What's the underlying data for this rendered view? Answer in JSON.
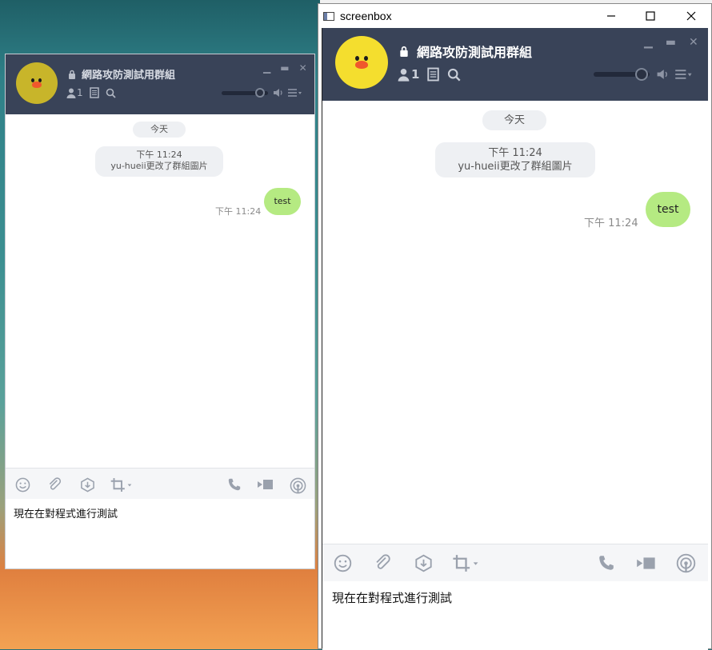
{
  "screenbox": {
    "title": "screenbox",
    "minimize": "—",
    "maximize": "☐",
    "close": "✕"
  },
  "chat": {
    "group_name": "網路攻防測試用群組",
    "member_count": "1",
    "date_divider": "今天",
    "system_time": "下午 11:24",
    "system_text": "yu-hueii更改了群組圖片",
    "message_text": "test",
    "message_time": "下午 11:24",
    "input_text": "現在在對程式進行測試"
  },
  "colors": {
    "header_bg": "#394358",
    "bubble": "#b5ea82",
    "avatar": "#f4de2e"
  },
  "icons": {
    "lock": "lock-icon",
    "member": "person-icon",
    "notes": "notes-icon",
    "search": "search-icon",
    "volume": "speaker-icon",
    "menu": "menu-icon",
    "emoji": "smile-icon",
    "attach": "paperclip-icon",
    "download": "download-icon",
    "crop": "crop-icon",
    "call": "phone-icon",
    "video": "video-icon",
    "broadcast": "broadcast-icon"
  }
}
